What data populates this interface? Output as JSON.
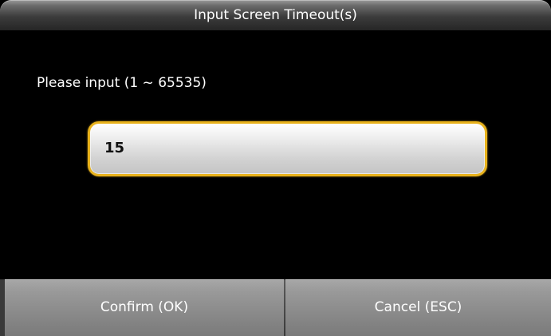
{
  "dialog": {
    "title": "Input Screen Timeout(s)",
    "prompt": "Please input (1 ~ 65535)"
  },
  "input": {
    "value": "15"
  },
  "buttons": {
    "confirm_label": "Confirm (OK)",
    "cancel_label": "Cancel (ESC)"
  },
  "colors": {
    "background": "#000000",
    "input_border": "#e8b21c",
    "text": "#ffffff"
  }
}
